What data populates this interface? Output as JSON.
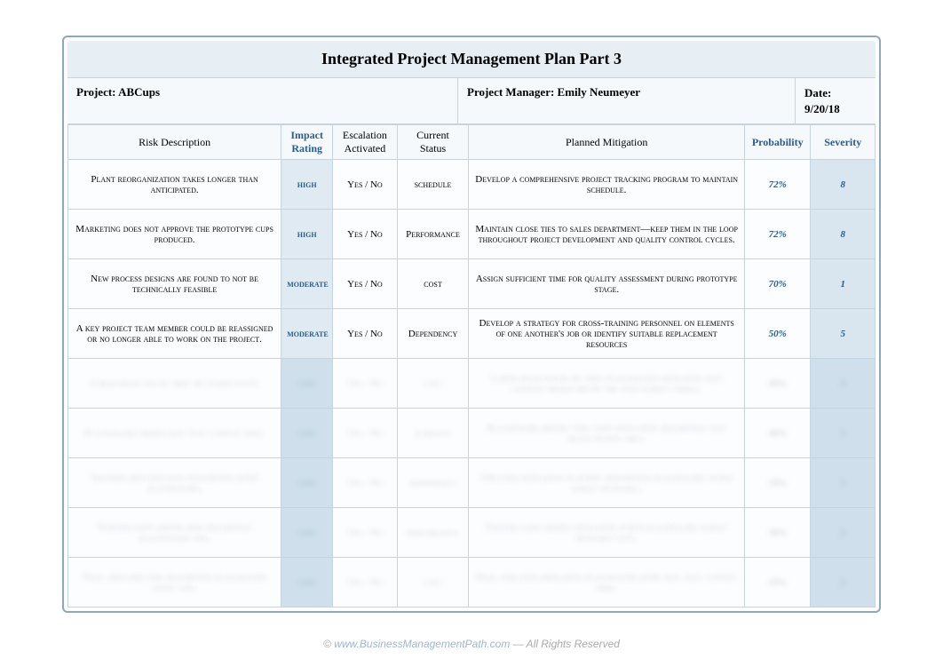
{
  "title": "Integrated Project Management Plan Part 3",
  "meta": {
    "project_label": "Project:",
    "project_name": "ABCups",
    "manager_label": "Project Manager:",
    "manager_name": "Emily Neumeyer",
    "date_label": "Date:",
    "date_value": "9/20/18"
  },
  "headers": {
    "desc": "Risk Description",
    "impact": "Impact Rating",
    "escal": "Escalation Activated",
    "status": "Current Status",
    "mitig": "Planned Mitigation",
    "prob": "Probability",
    "sev": "Severity"
  },
  "rows": [
    {
      "desc": "Plant reorganization takes longer than anticipated.",
      "impact": "high",
      "escal": "Yes / No",
      "status": "schedule",
      "mitig": "Develop a comprehensive project tracking program to maintain schedule.",
      "prob": "72%",
      "sev": "8",
      "ghost": false
    },
    {
      "desc": "Marketing does not approve the prototype cups produced.",
      "impact": "high",
      "escal": "Yes / No",
      "status": "Performance",
      "mitig": "Maintain close ties to sales department—keep them in the loop throughout project development and quality control cycles.",
      "prob": "72%",
      "sev": "8",
      "ghost": false
    },
    {
      "desc": "New process designs are found to not be technically feasible",
      "impact": "moderate",
      "escal": "Yes / No",
      "status": "cost",
      "mitig": "Assign sufficient time for quality assessment during prototype stage.",
      "prob": "70%",
      "sev": "1",
      "ghost": false
    },
    {
      "desc": "A key project team member could be reassigned or no longer able to work on the project.",
      "impact": "moderate",
      "escal": "Yes / No",
      "status": "Dependency",
      "mitig": "Develop a strategy for cross-training personnel on elements of one another's job or identify suitable replacement resources",
      "prob": "50%",
      "sev": "5",
      "ghost": false
    },
    {
      "desc": "Lorem ipsum dolor amet sit consectetur.",
      "impact": "low",
      "escal": "Yes / No",
      "status": "cost",
      "mitig": "Lorem ipsum dolor sit amet placeholder mitigation text content hidden below the fold barely visible.",
      "prob": "45%",
      "sev": "4",
      "ghost": true
    },
    {
      "desc": "Placeholder hidden row text content item.",
      "impact": "low",
      "escal": "Yes / No",
      "status": "schedule",
      "mitig": "Placeholder hidden very faint mitigation description text block region area.",
      "prob": "40%",
      "sev": "3",
      "ghost": true
    },
    {
      "desc": "Another obscured row description entry placeholder.",
      "impact": "low",
      "escal": "Yes / No",
      "status": "dependency",
      "mitig": "Obscured mitigation planning description placeholder words barely readable.",
      "prob": "35%",
      "sev": "3",
      "ghost": true
    },
    {
      "desc": "Further faint hidden risk description placeholder line.",
      "impact": "low",
      "escal": "Yes / No",
      "status": "performance",
      "mitig": "Further faint hidden mitigation words placeholder barely readable text.",
      "prob": "30%",
      "sev": "2",
      "ghost": true
    },
    {
      "desc": "Final obscured risk description placeholder entry line.",
      "impact": "low",
      "escal": "Yes / No",
      "status": "cost",
      "mitig": "Final obscured mitigation placeholder entry row text content here.",
      "prob": "25%",
      "sev": "2",
      "ghost": true
    }
  ],
  "footer": {
    "prefix": "©",
    "link_text": "www.BusinessManagementPath.com",
    "suffix": " — All Rights Reserved"
  }
}
